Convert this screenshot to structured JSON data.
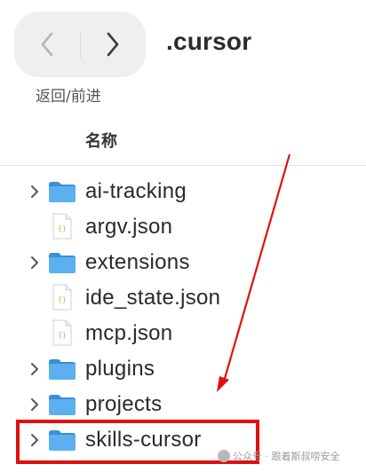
{
  "window": {
    "title": ".cursor"
  },
  "toolbar": {
    "nav_label": "返回/前进"
  },
  "columns": {
    "name_header": "名称"
  },
  "files": [
    {
      "name": "ai-tracking",
      "type": "folder",
      "expandable": true
    },
    {
      "name": "argv.json",
      "type": "json",
      "expandable": false
    },
    {
      "name": "extensions",
      "type": "folder",
      "expandable": true
    },
    {
      "name": "ide_state.json",
      "type": "json",
      "expandable": false
    },
    {
      "name": "mcp.json",
      "type": "json",
      "expandable": false
    },
    {
      "name": "plugins",
      "type": "folder",
      "expandable": true
    },
    {
      "name": "projects",
      "type": "folder",
      "expandable": true
    },
    {
      "name": "skills-cursor",
      "type": "folder",
      "expandable": true
    }
  ],
  "annotation": {
    "highlight_target": "skills-cursor",
    "color": "#e01010"
  },
  "watermark": {
    "text": "公众号 · 跟着斯叔唠安全"
  },
  "colors": {
    "folder": "#4aa3ea",
    "folder_dark": "#3a8fd6",
    "json_icon_text": "#c9b24a"
  },
  "icons": {
    "back": "chevron-left-icon",
    "forward": "chevron-right-icon",
    "expand": "chevron-right-icon"
  }
}
